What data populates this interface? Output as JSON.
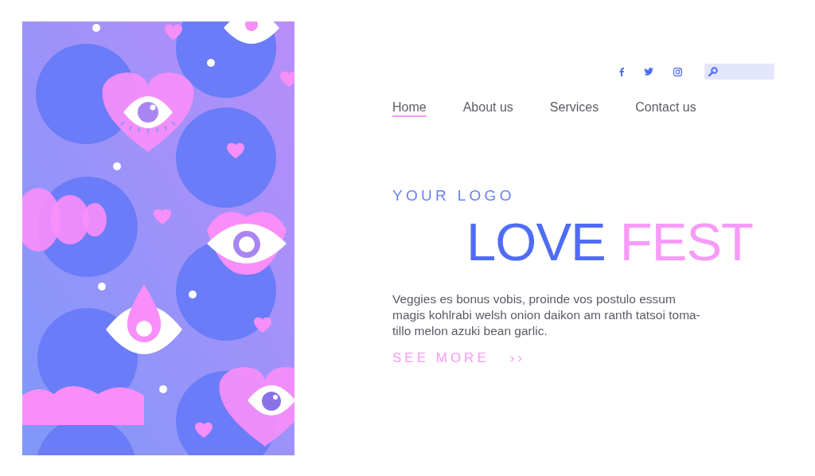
{
  "social_links": [
    {
      "kind": "facebook"
    },
    {
      "kind": "twitter"
    },
    {
      "kind": "instagram"
    }
  ],
  "nav": [
    {
      "label": "Home",
      "selected": true
    },
    {
      "label": "About us",
      "selected": false
    },
    {
      "label": "Services",
      "selected": false
    },
    {
      "label": "Contact us",
      "selected": false
    }
  ],
  "hero": {
    "logo": "YOUR LOGO",
    "title": [
      {
        "text": "LOVE",
        "color": "#4f6cf6"
      },
      {
        "text": "FEST",
        "color": "#f79af8"
      }
    ],
    "body": "Veggies es bonus vobis, proinde vos postulo essum\nmagis kohlrabi welsh onion daikon am ranth tatsoi toma-\ntillo melon azuki bean garlic.",
    "see_more": {
      "label": "SEE MORE",
      "arrow": "››"
    }
  }
}
